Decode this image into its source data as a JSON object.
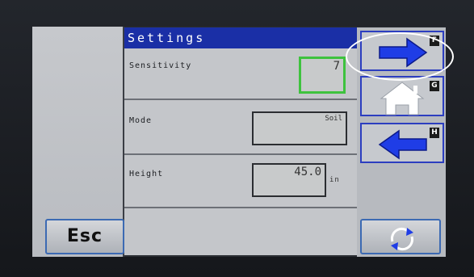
{
  "header": {
    "title": "Settings"
  },
  "rows": [
    {
      "label": "Sensitivity",
      "value": "7"
    },
    {
      "label": "Mode",
      "value": "Soil"
    },
    {
      "label": "Height",
      "value": "45.0",
      "unit": "in"
    }
  ],
  "nav": [
    {
      "key": "F",
      "icon": "arrow-right-icon"
    },
    {
      "key": "G",
      "icon": "home-icon"
    },
    {
      "key": "H",
      "icon": "arrow-left-icon"
    }
  ],
  "footer": {
    "esc_label": "Esc",
    "refresh_icon": "refresh-icon"
  },
  "colors": {
    "header_bg": "#1a2fa6",
    "arrow_blue": "#1f3de6",
    "active_border": "#3ec23e",
    "highlight_oval": "#ffffff"
  }
}
